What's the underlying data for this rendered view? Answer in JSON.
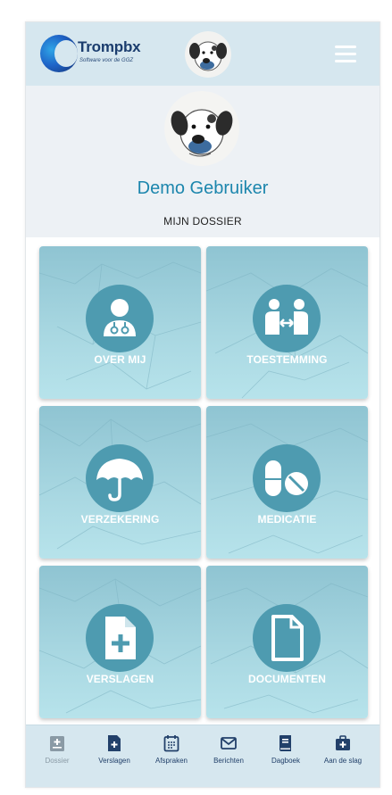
{
  "header": {
    "logo_title": "Trompbx",
    "logo_subtitle": "Software voor de GGZ",
    "menu_icon": "hamburger-menu-icon"
  },
  "profile": {
    "user_name": "Demo Gebruiker",
    "section_label": "MIJN DOSSIER"
  },
  "tiles": [
    {
      "label": "OVER MIJ",
      "icon": "doctor-icon"
    },
    {
      "label": "TOESTEMMING",
      "icon": "consent-people-icon"
    },
    {
      "label": "VERZEKERING",
      "icon": "umbrella-icon"
    },
    {
      "label": "MEDICATIE",
      "icon": "pills-icon"
    },
    {
      "label": "VERSLAGEN",
      "icon": "medical-file-icon"
    },
    {
      "label": "DOCUMENTEN",
      "icon": "document-icon"
    }
  ],
  "bottom_nav": [
    {
      "label": "Dossier",
      "icon": "medical-folder-icon",
      "state": "disabled"
    },
    {
      "label": "Verslagen",
      "icon": "medical-file-icon",
      "state": "active"
    },
    {
      "label": "Afspraken",
      "icon": "calendar-icon",
      "state": "active"
    },
    {
      "label": "Berichten",
      "icon": "envelope-icon",
      "state": "active"
    },
    {
      "label": "Dagboek",
      "icon": "book-icon",
      "state": "active"
    },
    {
      "label": "Aan de slag",
      "icon": "first-aid-kit-icon",
      "state": "active"
    }
  ],
  "colors": {
    "header_bg": "#d6e7ef",
    "accent_blue": "#1c86ad",
    "tile_circle": "#4e9bb0",
    "nav_icon": "#22406a",
    "nav_icon_disabled": "#8a9aa5"
  }
}
